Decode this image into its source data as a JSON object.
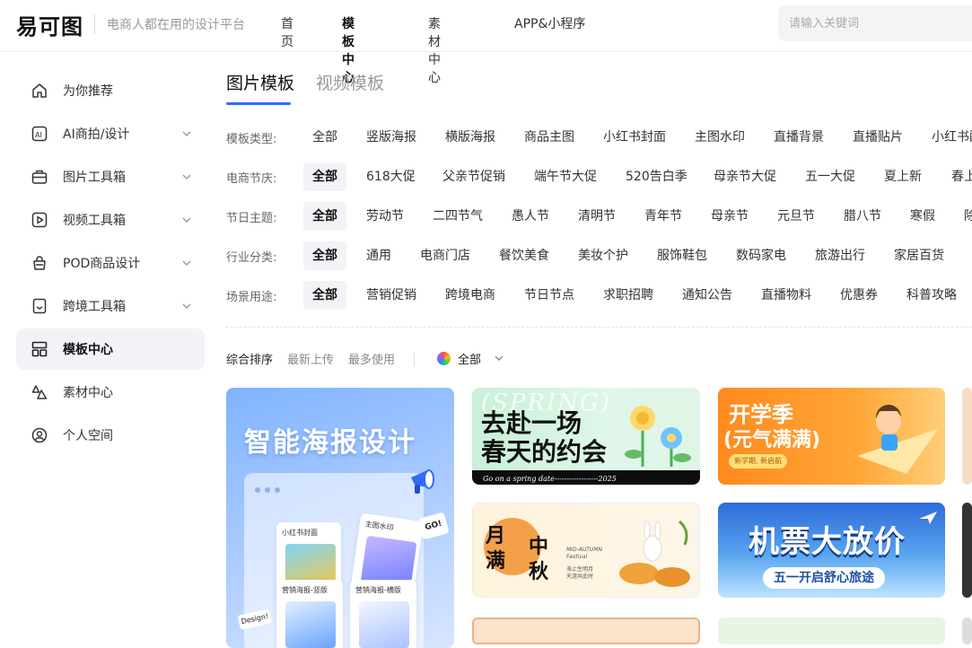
{
  "header": {
    "logo": "易可图",
    "slogan": "电商人都在用的设计平台",
    "nav": [
      "首页",
      "模板中心",
      "素材中心",
      "APP&小程序"
    ],
    "search_placeholder": "请输入关键词"
  },
  "sidebar": {
    "items": [
      {
        "label": "为你推荐",
        "icon": "home-icon",
        "expandable": false
      },
      {
        "label": "AI商拍/设计",
        "icon": "ai-icon",
        "expandable": true
      },
      {
        "label": "图片工具箱",
        "icon": "toolbox-icon",
        "expandable": true
      },
      {
        "label": "视频工具箱",
        "icon": "video-icon",
        "expandable": true
      },
      {
        "label": "POD商品设计",
        "icon": "bag-icon",
        "expandable": true
      },
      {
        "label": "跨境工具箱",
        "icon": "bookmark-icon",
        "expandable": true
      },
      {
        "label": "模板中心",
        "icon": "template-icon",
        "expandable": false,
        "active": true
      },
      {
        "label": "素材中心",
        "icon": "shapes-icon",
        "expandable": false
      },
      {
        "label": "个人空间",
        "icon": "user-icon",
        "expandable": false
      }
    ]
  },
  "main": {
    "tabs": [
      "图片模板",
      "视频模板"
    ],
    "filters": [
      {
        "label": "模板类型:",
        "options": [
          "全部",
          "竖版海报",
          "横版海报",
          "商品主图",
          "小红书封面",
          "主图水印",
          "直播背景",
          "直播贴片",
          "小红书配图"
        ],
        "selected": -1
      },
      {
        "label": "电商节庆:",
        "options": [
          "全部",
          "618大促",
          "父亲节促销",
          "端午节大促",
          "520告白季",
          "母亲节大促",
          "五一大促",
          "夏上新",
          "春上新"
        ],
        "selected": 0
      },
      {
        "label": "节日主题:",
        "options": [
          "全部",
          "劳动节",
          "二四节气",
          "愚人节",
          "清明节",
          "青年节",
          "母亲节",
          "元旦节",
          "腊八节",
          "寒假",
          "除夕"
        ],
        "selected": 0
      },
      {
        "label": "行业分类:",
        "options": [
          "全部",
          "通用",
          "电商门店",
          "餐饮美食",
          "美妆个护",
          "服饰鞋包",
          "数码家电",
          "旅游出行",
          "家居百货"
        ],
        "selected": 0
      },
      {
        "label": "场景用途:",
        "options": [
          "全部",
          "营销促销",
          "跨境电商",
          "节日节点",
          "求职招聘",
          "通知公告",
          "直播物料",
          "优惠券",
          "科普攻略"
        ],
        "selected": 0
      }
    ],
    "sort": [
      "综合排序",
      "最新上传",
      "最多使用"
    ],
    "color_filter": "全部"
  },
  "cards": {
    "big": {
      "title": "智能海报设计",
      "mini1": "小红书封面",
      "mini2": "主图水印",
      "mini3": "营销海报-竖版",
      "mini4": "营销海报-横版",
      "go": "GO!",
      "design": "Design!"
    },
    "spring": {
      "en": "(SPRING)",
      "line1": "去赴一场",
      "line2": "春天的约会",
      "bar": "Go on a spring date------------------2025"
    },
    "school": {
      "line1": "开学季",
      "line2": "(元气满满)",
      "pill": "新学期, 新启航"
    },
    "midautumn": {
      "c1": "月",
      "c2": "满",
      "c3": "中",
      "c4": "秋",
      "en1": "MID-AUTUMN",
      "en2": "Festival",
      "note1": "海上生明月",
      "note2": "天涯共此时"
    },
    "ticket": {
      "title": "机票大放价",
      "pill": "五一开启舒心旅途"
    }
  }
}
